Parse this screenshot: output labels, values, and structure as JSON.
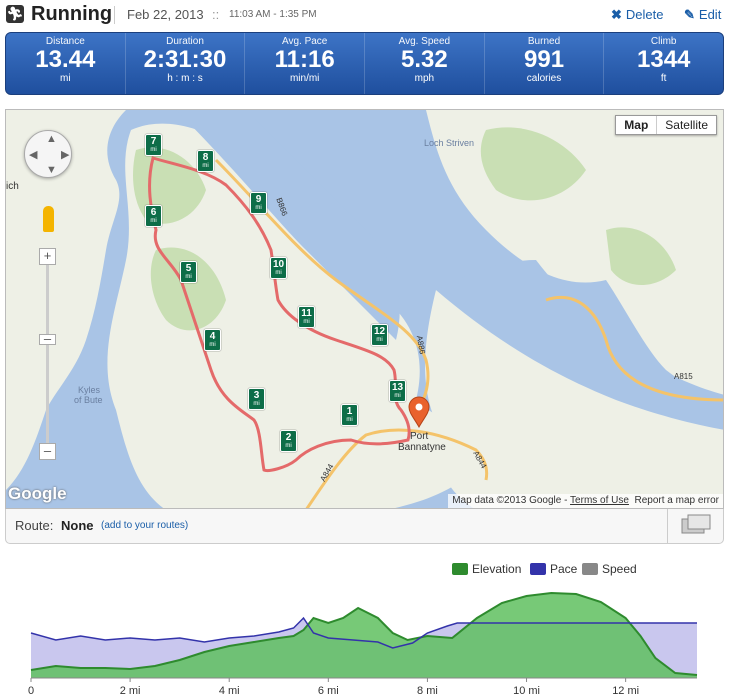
{
  "header": {
    "title": "Running",
    "date": "Feb 22, 2013",
    "separator": "::",
    "time_range": "11:03 AM - 1:35 PM",
    "delete_label": "Delete",
    "edit_label": "Edit"
  },
  "stats": [
    {
      "label": "Distance",
      "value": "13.44",
      "unit": "mi"
    },
    {
      "label": "Duration",
      "value": "2:31:30",
      "unit": "h : m : s"
    },
    {
      "label": "Avg. Pace",
      "value": "11:16",
      "unit": "min/mi"
    },
    {
      "label": "Avg. Speed",
      "value": "5.32",
      "unit": "mph"
    },
    {
      "label": "Burned",
      "value": "991",
      "unit": "calories"
    },
    {
      "label": "Climb",
      "value": "1344",
      "unit": "ft"
    }
  ],
  "map": {
    "type_map": "Map",
    "type_satellite": "Satellite",
    "place_loch": "Loch Striven",
    "place_kyles_1": "Kyles",
    "place_kyles_2": "of Bute",
    "place_port_1": "Port",
    "place_port_2": "Bannatyne",
    "place_ich": "ich",
    "road_a886": "A886",
    "road_a844_1": "A844",
    "road_a844_2": "A844",
    "road_a815": "A815",
    "road_b866": "B866",
    "google_logo": "Google",
    "attribution": "Map data ©2013 Google -",
    "terms": "Terms of Use",
    "report": "Report a map error",
    "mile_unit": "mi",
    "mile_markers": [
      "1",
      "2",
      "3",
      "4",
      "5",
      "6",
      "7",
      "8",
      "9",
      "10",
      "11",
      "12",
      "13"
    ]
  },
  "route": {
    "label": "Route:",
    "value": "None",
    "link": "(add to your routes)"
  },
  "chart_data": {
    "type": "area",
    "series": [
      {
        "name": "Elevation",
        "color": "#2e8b2e"
      },
      {
        "name": "Pace",
        "color": "#3333aa"
      },
      {
        "name": "Speed",
        "color": "#888888"
      }
    ],
    "x_ticks": [
      "0",
      "2 mi",
      "4 mi",
      "6 mi",
      "8 mi",
      "10 mi",
      "12 mi"
    ],
    "x_tick_values": [
      0,
      2,
      4,
      6,
      8,
      10,
      12
    ],
    "xlim": [
      0,
      13.44
    ],
    "elevation": {
      "x": [
        0,
        0.5,
        1,
        1.5,
        2,
        2.5,
        3,
        3.5,
        4,
        4.5,
        5,
        5.3,
        5.5,
        5.7,
        6,
        6.3,
        6.6,
        7,
        7.3,
        7.6,
        8,
        8.5,
        9,
        9.5,
        10,
        10.5,
        11,
        11.5,
        12,
        12.3,
        12.6,
        13,
        13.44
      ],
      "y": [
        0.08,
        0.12,
        0.1,
        0.1,
        0.09,
        0.12,
        0.18,
        0.26,
        0.32,
        0.36,
        0.4,
        0.42,
        0.48,
        0.6,
        0.55,
        0.6,
        0.7,
        0.6,
        0.45,
        0.38,
        0.42,
        0.4,
        0.6,
        0.75,
        0.82,
        0.85,
        0.84,
        0.76,
        0.6,
        0.42,
        0.2,
        0.05,
        0.03
      ]
    },
    "pace": {
      "x": [
        0,
        0.5,
        1,
        1.5,
        2,
        2.5,
        3,
        3.5,
        4,
        4.5,
        5,
        5.3,
        5.5,
        5.7,
        6,
        6.5,
        7,
        7.3,
        7.7,
        8,
        8.4,
        8.6,
        13.44
      ],
      "y": [
        0.45,
        0.38,
        0.42,
        0.38,
        0.4,
        0.38,
        0.4,
        0.36,
        0.4,
        0.42,
        0.46,
        0.5,
        0.6,
        0.45,
        0.4,
        0.38,
        0.36,
        0.3,
        0.35,
        0.45,
        0.52,
        0.55,
        0.55
      ]
    }
  }
}
